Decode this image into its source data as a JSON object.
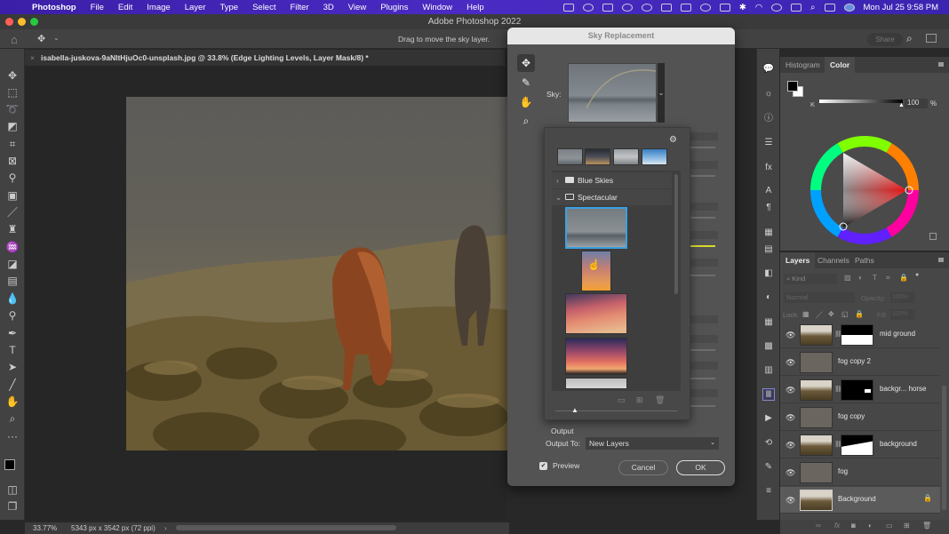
{
  "menubar": {
    "app": "Photoshop",
    "items": [
      "File",
      "Edit",
      "Image",
      "Layer",
      "Type",
      "Select",
      "Filter",
      "3D",
      "View",
      "Plugins",
      "Window",
      "Help"
    ],
    "clock": "Mon Jul 25  9:58 PM"
  },
  "window": {
    "title": "Adobe Photoshop 2022"
  },
  "options_bar": {
    "hint": "Drag to move the sky layer.",
    "share_label": "Share"
  },
  "document_tab": {
    "name": "isabella-juskova-9aNltHjuOc0-unsplash.jpg @ 33.8% (Edge Lighting Levels, Layer Mask/8) *"
  },
  "status": {
    "zoom": "33.77%",
    "dimensions": "5343 px x 3542 px (72 ppi)"
  },
  "dialog": {
    "title": "Sky Replacement",
    "sky_label": "Sky:",
    "presets": {
      "folders": [
        {
          "name": "Blue Skies",
          "expanded": false
        },
        {
          "name": "Spectacular",
          "expanded": true
        }
      ]
    },
    "output_section": "Output",
    "output_to_label": "Output To:",
    "output_to_value": "New Layers",
    "preview_label": "Preview",
    "preview_checked": true,
    "cancel_label": "Cancel",
    "ok_label": "OK"
  },
  "color_panel": {
    "tabs": [
      "Histogram",
      "Color"
    ],
    "active_tab": "Color",
    "channel_label": "K",
    "value": "100",
    "unit": "%"
  },
  "layers_panel": {
    "tabs": [
      "Layers",
      "Channels",
      "Paths"
    ],
    "active_tab": "Layers",
    "search_placeholder": "Kind",
    "blend_mode": "Normal",
    "opacity_label": "Opacity:",
    "opacity_value": "100%",
    "lock_label": "Lock:",
    "fill_label": "Fill:",
    "fill_value": "100%",
    "layers": [
      {
        "name": "mid ground",
        "has_mask": true
      },
      {
        "name": "fog copy 2",
        "has_mask": false
      },
      {
        "name": "backgr... horse",
        "has_mask": true
      },
      {
        "name": "fog copy",
        "has_mask": false
      },
      {
        "name": "background",
        "has_mask": true
      },
      {
        "name": "fog",
        "has_mask": false
      },
      {
        "name": "Background",
        "has_mask": false,
        "locked": true,
        "selected": true
      }
    ]
  }
}
